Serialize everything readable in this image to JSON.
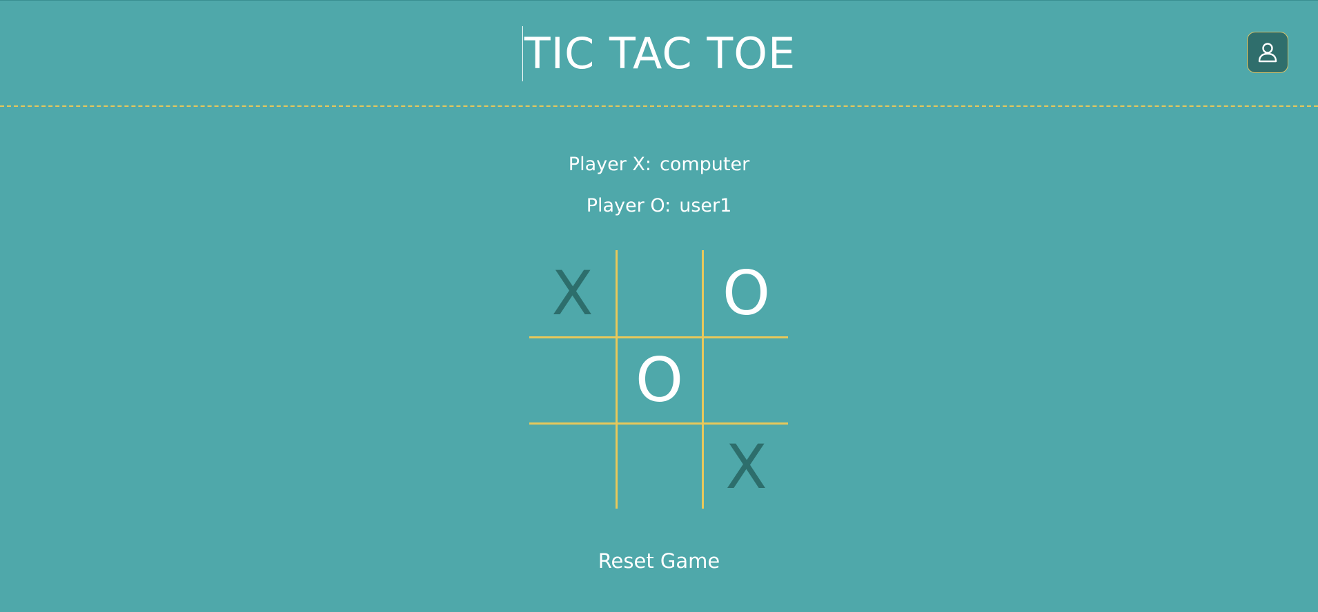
{
  "header": {
    "title": "TIC TAC TOE",
    "profile_icon": "user-icon"
  },
  "players": {
    "x_label": "Player X:",
    "x_name": "computer",
    "o_label": "Player O:",
    "o_name": "user1"
  },
  "board": {
    "cells": [
      "X",
      "",
      "O",
      "",
      "O",
      "",
      "",
      "",
      "X"
    ]
  },
  "actions": {
    "reset_label": "Reset Game"
  },
  "colors": {
    "background": "#4fa8aa",
    "grid": "#e8c85a",
    "x_mark": "#2d6e6c",
    "o_mark": "#ffffff",
    "profile_button": "#2f6e6c"
  }
}
